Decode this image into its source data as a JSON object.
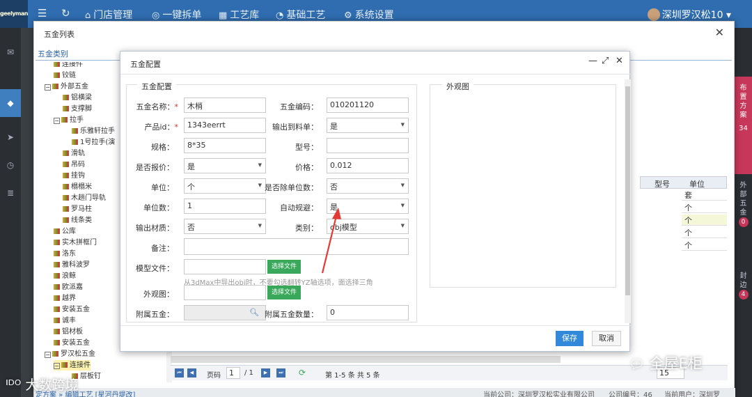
{
  "nav": {
    "logo": "geelyman",
    "items": [
      "门店管理",
      "一键拆单",
      "工艺库",
      "基础工艺",
      "系统设置"
    ],
    "user": "深圳罗汉松10"
  },
  "side_strip": {
    "red_label": "布置方案",
    "red_count": "34",
    "label2": "外部五金",
    "count2": "0",
    "label3": "封边",
    "count3": "4"
  },
  "outer": {
    "title": "五金列表",
    "category_tab": "五金类别",
    "tree": [
      {
        "text": "连接件",
        "indent": 1
      },
      {
        "text": "铰链",
        "indent": 1
      },
      {
        "text": "外部五金",
        "indent": 0,
        "toggle": "⊟"
      },
      {
        "text": "铝横梁",
        "indent": 2
      },
      {
        "text": "支撑脚",
        "indent": 2
      },
      {
        "text": "拉手",
        "indent": 1,
        "toggle": "⊟"
      },
      {
        "text": "乐雅轩拉手",
        "indent": 3
      },
      {
        "text": "1号拉手(演",
        "indent": 3
      },
      {
        "text": "滑轨",
        "indent": 2
      },
      {
        "text": "吊码",
        "indent": 2
      },
      {
        "text": "挂钩",
        "indent": 2
      },
      {
        "text": "榻榻米",
        "indent": 2
      },
      {
        "text": "木趟门导轨",
        "indent": 2
      },
      {
        "text": "罗马柱",
        "indent": 2
      },
      {
        "text": "线条类",
        "indent": 2
      },
      {
        "text": "公库",
        "indent": 1
      },
      {
        "text": "实木拼框门",
        "indent": 1
      },
      {
        "text": "洛东",
        "indent": 1
      },
      {
        "text": "雅科波罗",
        "indent": 1
      },
      {
        "text": "浪鲸",
        "indent": 1
      },
      {
        "text": "欧派嘉",
        "indent": 1
      },
      {
        "text": "越界",
        "indent": 1
      },
      {
        "text": "安装五金",
        "indent": 1
      },
      {
        "text": "诚丰",
        "indent": 1
      },
      {
        "text": "铝材板",
        "indent": 1
      },
      {
        "text": "安装五金",
        "indent": 1
      },
      {
        "text": "罗汉松五金",
        "indent": 0,
        "toggle": "⊟"
      },
      {
        "text": "连接件",
        "indent": 1,
        "toggle": "⊟",
        "selected": true
      },
      {
        "text": "层板钉",
        "indent": 3
      }
    ],
    "grid_headers": [
      "型号",
      "单位"
    ],
    "grid_units": [
      "套",
      "个",
      "个",
      "个",
      "个"
    ],
    "pager": {
      "page_label": "页码",
      "page": "1",
      "total": "/ 1",
      "summary": "第 1-5 条  共 5 条",
      "page_size": "15"
    },
    "footer": {
      "company": "当前公司：深圳罗汉松实业有限公司",
      "code": "公司编号：46",
      "user": "当前用户：深圳罗"
    },
    "footer_left": "定方案 » 编辑工艺 [星河丹堤改]"
  },
  "modal": {
    "title": "五金配置",
    "section_title": "五金配置",
    "preview_title": "外观图",
    "fields": {
      "name_label": "五金名称：",
      "name": "木梢",
      "code_label": "五金编码：",
      "code": "010201120",
      "product_label": "产品id：",
      "product": "1343eerrt",
      "output_label": "输出到料单：",
      "output": "是",
      "spec_label": "规格：",
      "spec": "8*35",
      "model_label": "型号：",
      "model": "",
      "quote_label": "是否报价：",
      "quote": "是",
      "price_label": "价格：",
      "price": "0.012",
      "unit_label": "单位：",
      "unit": "个",
      "divide_label": "是否除单位数：",
      "divide": "否",
      "unitcount_label": "单位数：",
      "unitcount": "1",
      "avoid_label": "自动规避：",
      "avoid": "是",
      "material_label": "输出材质：",
      "material": "否",
      "category_label": "类别：",
      "category": "obj模型",
      "note_label": "备注：",
      "note": "",
      "modelfile_label": "模型文件：",
      "modelfile": "",
      "choose_file": "选择文件",
      "hint": "从3dMax中导出obj时，不要勾选翻转YZ轴选项，面选择三角",
      "appearance_label": "外观图：",
      "appearance": "",
      "attached_label": "附属五金：",
      "attached": "",
      "attached_count_label": "附属五金数量：",
      "attached_count": "0"
    },
    "save": "保存",
    "cancel": "取消"
  },
  "watermarks": {
    "left": "大数跨境",
    "right": "全屋E柜"
  },
  "colors": {
    "nav": "#2f6db0",
    "save": "#3288d9",
    "file_button": "#3aa85a",
    "arrow": "#e53935",
    "strip_red": "#c63759"
  }
}
